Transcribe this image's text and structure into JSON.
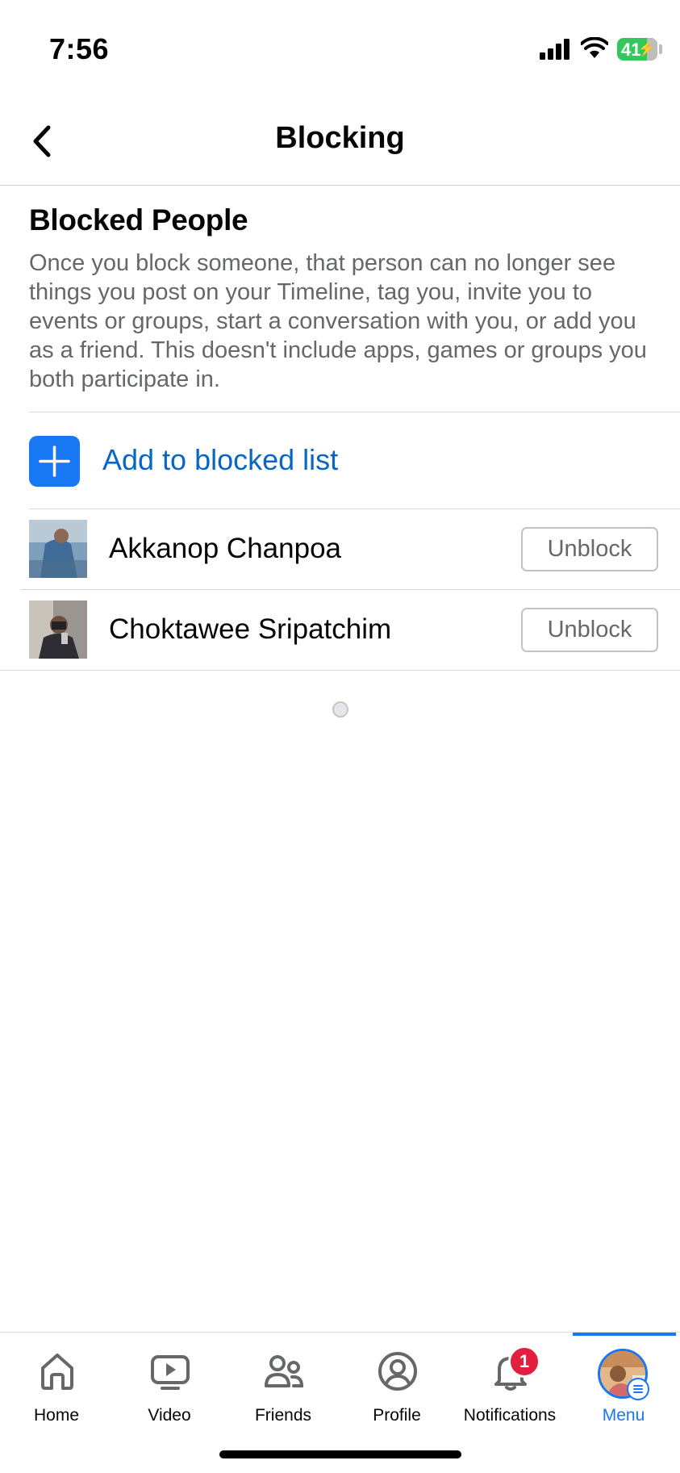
{
  "status_bar": {
    "time": "7:56",
    "battery_level": "41",
    "signal_icon": "cellular-signal-icon",
    "wifi_icon": "wifi-icon",
    "battery_color": "#34c759"
  },
  "header": {
    "title": "Blocking",
    "back_icon": "chevron-left-icon"
  },
  "section": {
    "title": "Blocked People",
    "description": "Once you block someone, that person can no longer see things you post on your Timeline, tag you, invite you to events or groups, start a conversation with you, or add you as a friend. This doesn't include apps, games or groups you both participate in."
  },
  "add_row": {
    "label": "Add to blocked list",
    "icon": "plus-icon",
    "accent": "#1877f2"
  },
  "blocked_people": [
    {
      "name": "Akkanop Chanpoa",
      "button_label": "Unblock"
    },
    {
      "name": "Choktawee Sripatchim",
      "button_label": "Unblock"
    }
  ],
  "bottom_nav": {
    "items": [
      {
        "label": "Home",
        "icon": "home-icon"
      },
      {
        "label": "Video",
        "icon": "video-icon"
      },
      {
        "label": "Friends",
        "icon": "friends-icon"
      },
      {
        "label": "Profile",
        "icon": "profile-icon"
      },
      {
        "label": "Notifications",
        "icon": "bell-icon",
        "badge": "1"
      },
      {
        "label": "Menu",
        "icon": "menu-avatar-icon",
        "active": true
      }
    ]
  }
}
